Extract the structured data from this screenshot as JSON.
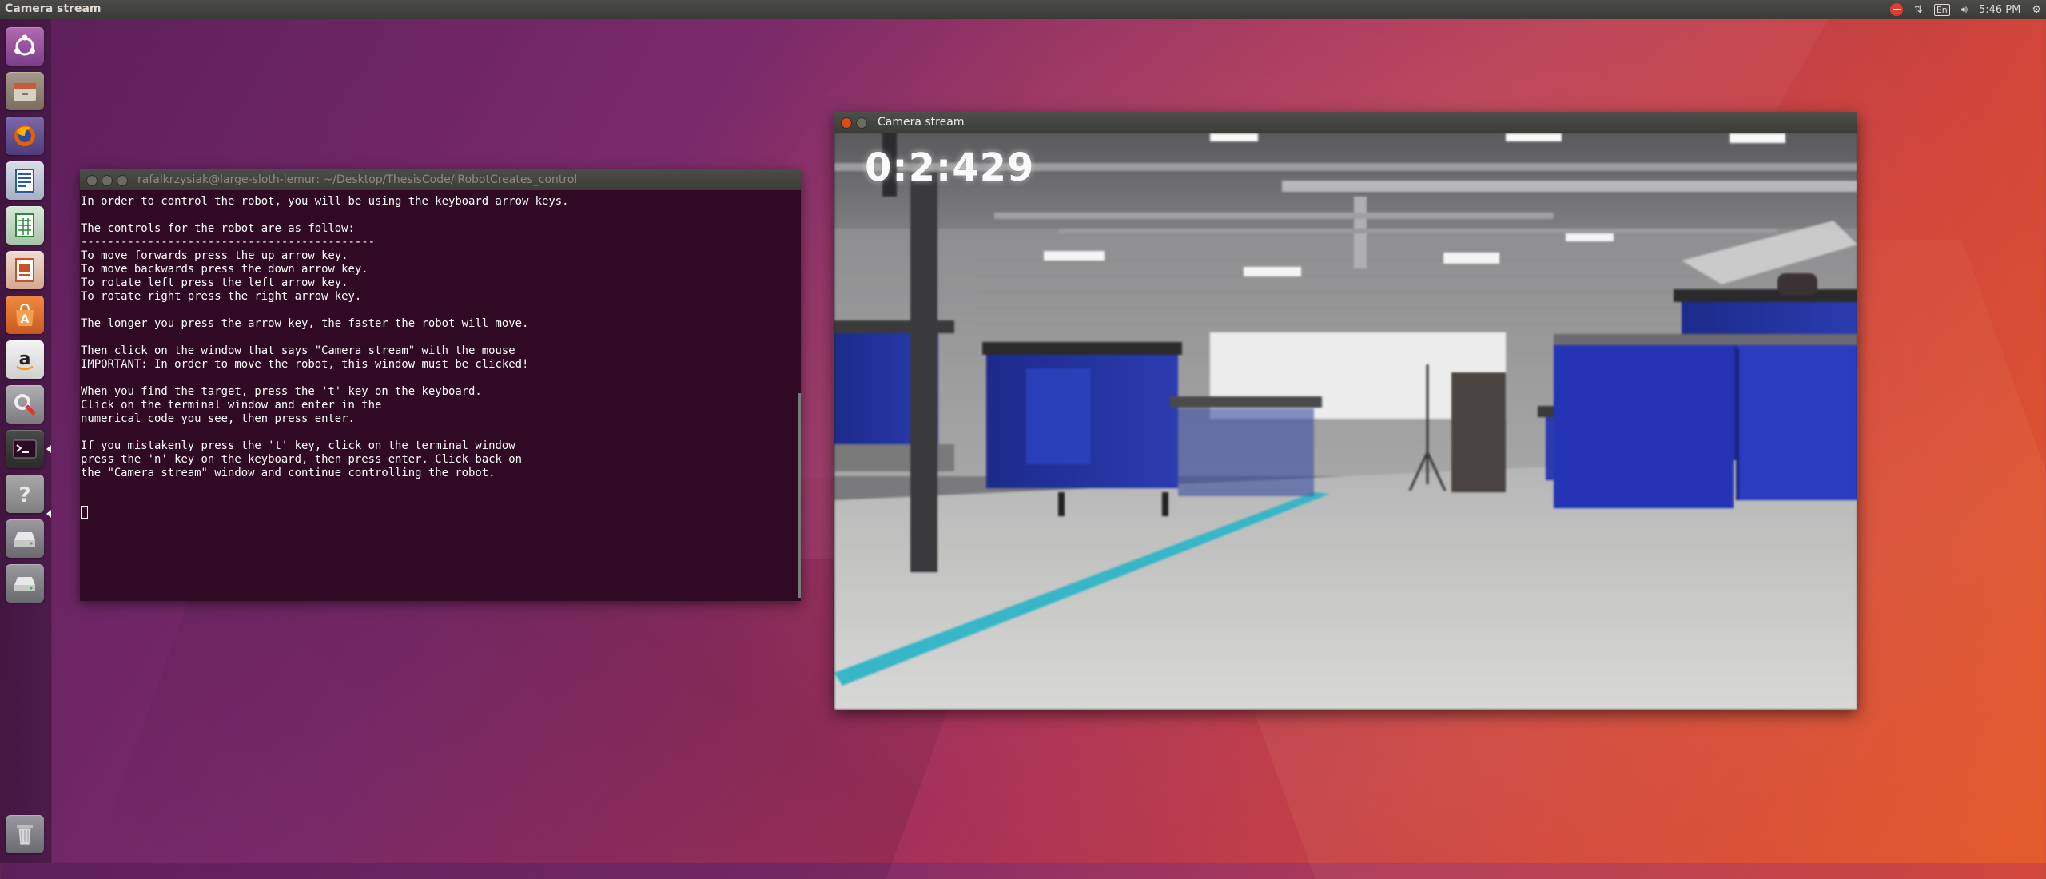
{
  "panel": {
    "app_title": "Camera stream",
    "keyboard_layout": "En",
    "clock": "5:46 PM"
  },
  "launcher": {
    "items": [
      {
        "name": "dash-icon"
      },
      {
        "name": "files-icon"
      },
      {
        "name": "firefox-icon"
      },
      {
        "name": "writer-icon"
      },
      {
        "name": "calc-icon"
      },
      {
        "name": "impress-icon"
      },
      {
        "name": "software-center-icon"
      },
      {
        "name": "amazon-icon"
      },
      {
        "name": "system-settings-icon"
      },
      {
        "name": "terminal-icon"
      },
      {
        "name": "help-icon"
      },
      {
        "name": "drive-icon"
      },
      {
        "name": "drive-icon"
      },
      {
        "name": "trash-icon"
      }
    ]
  },
  "terminal": {
    "title": "rafalkrzysiak@large-sloth-lemur: ~/Desktop/ThesisCode/iRobotCreates_control",
    "output": "In order to control the robot, you will be using the keyboard arrow keys.\n\nThe controls for the robot are as follow:\n--------------------------------------------\nTo move forwards press the up arrow key.\nTo move backwards press the down arrow key.\nTo rotate left press the left arrow key.\nTo rotate right press the right arrow key.\n\nThe longer you press the arrow key, the faster the robot will move.\n\nThen click on the window that says \"Camera stream\" with the mouse\nIMPORTANT: In order to move the robot, this window must be clicked!\n\nWhen you find the target, press the 't' key on the keyboard.\nClick on the terminal window and enter in the\nnumerical code you see, then press enter.\n\nIf you mistakenly press the 't' key, click on the terminal window\npress the 'n' key on the keyboard, then press enter. Click back on\nthe \"Camera stream\" window and continue controlling the robot.\n"
  },
  "camera": {
    "title": "Camera stream",
    "timer": "0:2:429"
  }
}
